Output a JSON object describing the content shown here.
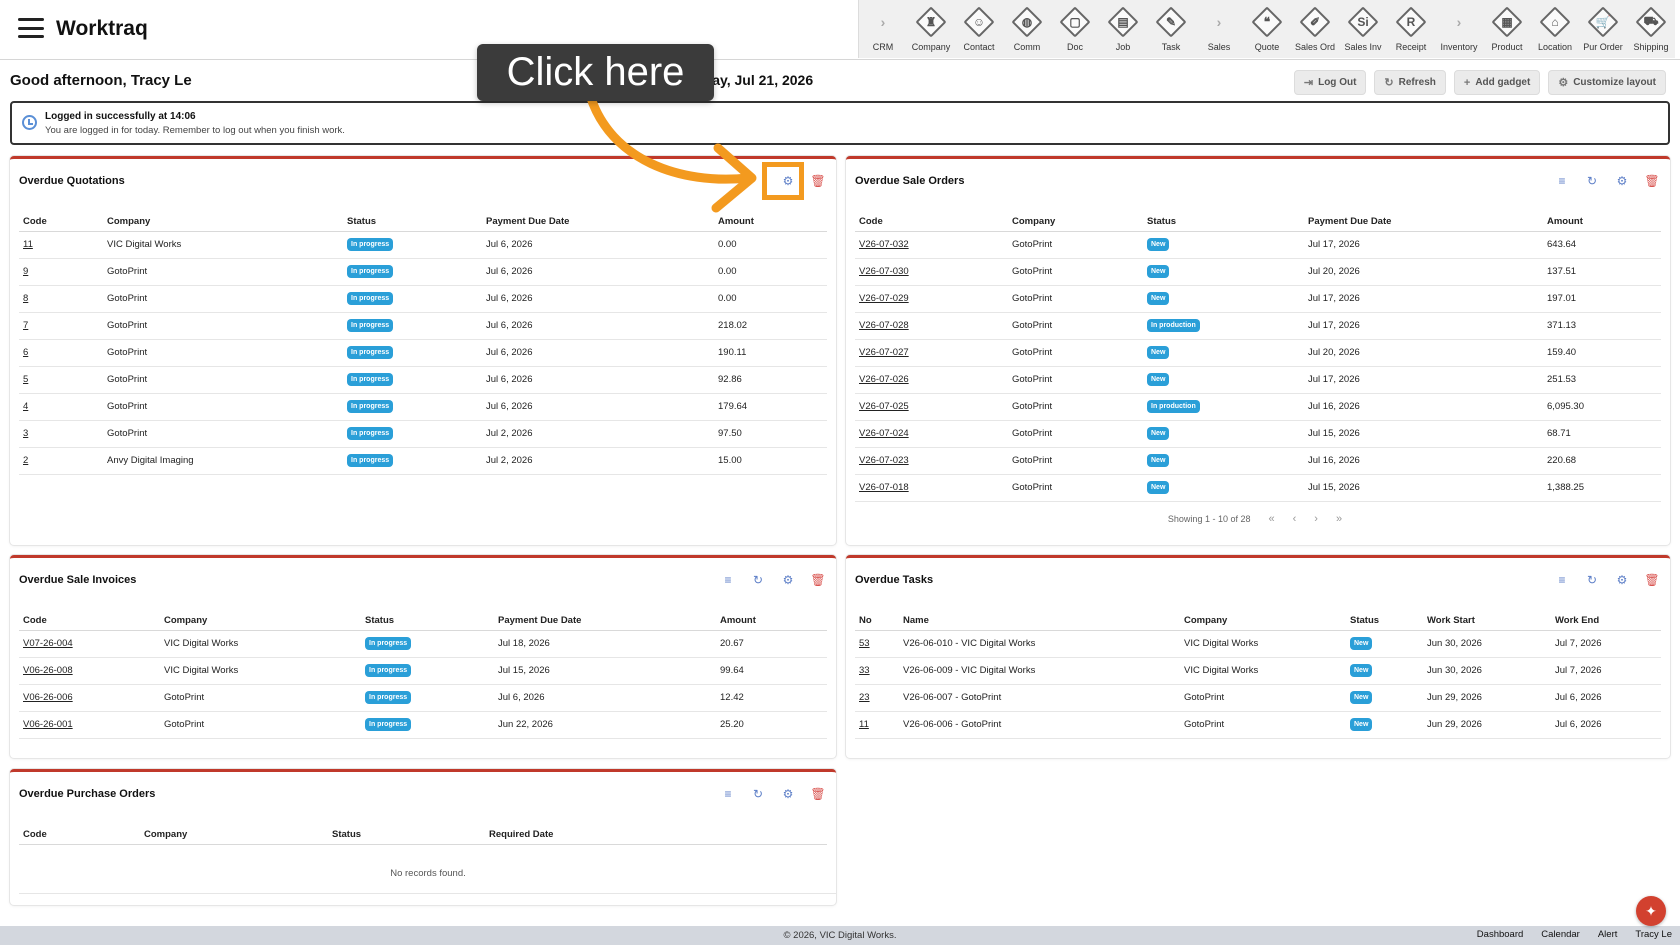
{
  "app": {
    "brand": "Worktraq",
    "modules": [
      {
        "label": "CRM",
        "icon": "chevron-right-icon",
        "glyph": "›",
        "arrow": true
      },
      {
        "label": "Company",
        "icon": "company-icon",
        "glyph": "♜",
        "arrow": false
      },
      {
        "label": "Contact",
        "icon": "contact-icon",
        "glyph": "☺",
        "arrow": false
      },
      {
        "label": "Comm",
        "icon": "comm-icon",
        "glyph": "◍",
        "arrow": false
      },
      {
        "label": "Doc",
        "icon": "doc-icon",
        "glyph": "▢",
        "arrow": false
      },
      {
        "label": "Job",
        "icon": "job-icon",
        "glyph": "▤",
        "arrow": false
      },
      {
        "label": "Task",
        "icon": "task-icon",
        "glyph": "✎",
        "arrow": false
      },
      {
        "label": "Sales",
        "icon": "chevron-right-icon",
        "glyph": "›",
        "arrow": true
      },
      {
        "label": "Quote",
        "icon": "quote-icon",
        "glyph": "❝",
        "arrow": false
      },
      {
        "label": "Sales Ord",
        "icon": "sales-order-icon",
        "glyph": "✐",
        "arrow": false
      },
      {
        "label": "Sales Inv",
        "icon": "sales-invoice-icon",
        "glyph": "Si",
        "arrow": false
      },
      {
        "label": "Receipt",
        "icon": "receipt-icon",
        "glyph": "R",
        "arrow": false
      },
      {
        "label": "Inventory",
        "icon": "chevron-right-icon",
        "glyph": "›",
        "arrow": true
      },
      {
        "label": "Product",
        "icon": "product-icon",
        "glyph": "▦",
        "arrow": false
      },
      {
        "label": "Location",
        "icon": "location-icon",
        "glyph": "⌂",
        "arrow": false
      },
      {
        "label": "Pur Order",
        "icon": "purchase-order-icon",
        "glyph": "🛒",
        "arrow": false
      },
      {
        "label": "Shipping",
        "icon": "shipping-icon",
        "glyph": "⛟",
        "arrow": false
      }
    ]
  },
  "header": {
    "greeting": "Good afternoon, Tracy Le",
    "date": "Tuesday, Jul 21, 2026",
    "buttons": {
      "logout": "Log Out",
      "refresh": "Refresh",
      "add_gadget": "Add gadget",
      "customize": "Customize layout"
    }
  },
  "notice": {
    "title": "Logged in successfully at 14:06",
    "text": "You are logged in for today. Remember to log out when you finish work."
  },
  "quotations": {
    "title": "Overdue Quotations",
    "columns": [
      "Code",
      "Company",
      "Status",
      "Payment Due Date",
      "Amount"
    ],
    "rows": [
      {
        "code": "11",
        "company": "VIC Digital Works",
        "status": "In progress",
        "due": "Jul 6, 2026",
        "amount": "0.00"
      },
      {
        "code": "9",
        "company": "GotoPrint",
        "status": "In progress",
        "due": "Jul 6, 2026",
        "amount": "0.00"
      },
      {
        "code": "8",
        "company": "GotoPrint",
        "status": "In progress",
        "due": "Jul 6, 2026",
        "amount": "0.00"
      },
      {
        "code": "7",
        "company": "GotoPrint",
        "status": "In progress",
        "due": "Jul 6, 2026",
        "amount": "218.02"
      },
      {
        "code": "6",
        "company": "GotoPrint",
        "status": "In progress",
        "due": "Jul 6, 2026",
        "amount": "190.11"
      },
      {
        "code": "5",
        "company": "GotoPrint",
        "status": "In progress",
        "due": "Jul 6, 2026",
        "amount": "92.86"
      },
      {
        "code": "4",
        "company": "GotoPrint",
        "status": "In progress",
        "due": "Jul 6, 2026",
        "amount": "179.64"
      },
      {
        "code": "3",
        "company": "GotoPrint",
        "status": "In progress",
        "due": "Jul 2, 2026",
        "amount": "97.50"
      },
      {
        "code": "2",
        "company": "Anvy Digital Imaging",
        "status": "In progress",
        "due": "Jul 2, 2026",
        "amount": "15.00"
      }
    ]
  },
  "sale_orders": {
    "title": "Overdue Sale Orders",
    "columns": [
      "Code",
      "Company",
      "Status",
      "Payment Due Date",
      "Amount"
    ],
    "rows": [
      {
        "code": "V26-07-032",
        "company": "GotoPrint",
        "status": "New",
        "due": "Jul 17, 2026",
        "amount": "643.64"
      },
      {
        "code": "V26-07-030",
        "company": "GotoPrint",
        "status": "New",
        "due": "Jul 20, 2026",
        "amount": "137.51"
      },
      {
        "code": "V26-07-029",
        "company": "GotoPrint",
        "status": "New",
        "due": "Jul 17, 2026",
        "amount": "197.01"
      },
      {
        "code": "V26-07-028",
        "company": "GotoPrint",
        "status": "In production",
        "due": "Jul 17, 2026",
        "amount": "371.13"
      },
      {
        "code": "V26-07-027",
        "company": "GotoPrint",
        "status": "New",
        "due": "Jul 20, 2026",
        "amount": "159.40"
      },
      {
        "code": "V26-07-026",
        "company": "GotoPrint",
        "status": "New",
        "due": "Jul 17, 2026",
        "amount": "251.53"
      },
      {
        "code": "V26-07-025",
        "company": "GotoPrint",
        "status": "In production",
        "due": "Jul 16, 2026",
        "amount": "6,095.30"
      },
      {
        "code": "V26-07-024",
        "company": "GotoPrint",
        "status": "New",
        "due": "Jul 15, 2026",
        "amount": "68.71"
      },
      {
        "code": "V26-07-023",
        "company": "GotoPrint",
        "status": "New",
        "due": "Jul 16, 2026",
        "amount": "220.68"
      },
      {
        "code": "V26-07-018",
        "company": "GotoPrint",
        "status": "New",
        "due": "Jul 15, 2026",
        "amount": "1,388.25"
      }
    ],
    "pager_text": "Showing 1 - 10 of 28",
    "pager": {
      "first": "«",
      "prev": "‹",
      "next": "›",
      "last": "»"
    }
  },
  "sale_invoices": {
    "title": "Overdue Sale Invoices",
    "columns": [
      "Code",
      "Company",
      "Status",
      "Payment Due Date",
      "Amount"
    ],
    "rows": [
      {
        "code": "V07-26-004",
        "company": "VIC Digital Works",
        "status": "In progress",
        "due": "Jul 18, 2026",
        "amount": "20.67"
      },
      {
        "code": "V06-26-008",
        "company": "VIC Digital Works",
        "status": "In progress",
        "due": "Jul 15, 2026",
        "amount": "99.64"
      },
      {
        "code": "V06-26-006",
        "company": "GotoPrint",
        "status": "In progress",
        "due": "Jul 6, 2026",
        "amount": "12.42"
      },
      {
        "code": "V06-26-001",
        "company": "GotoPrint",
        "status": "In progress",
        "due": "Jun 22, 2026",
        "amount": "25.20"
      }
    ]
  },
  "tasks": {
    "title": "Overdue Tasks",
    "columns": [
      "No",
      "Name",
      "Company",
      "Status",
      "Work Start",
      "Work End"
    ],
    "rows": [
      {
        "no": "53",
        "name": "V26-06-010 - VIC Digital Works",
        "company": "VIC Digital Works",
        "status": "New",
        "start": "Jun 30, 2026",
        "end": "Jul 7, 2026"
      },
      {
        "no": "33",
        "name": "V26-06-009 - VIC Digital Works",
        "company": "VIC Digital Works",
        "status": "New",
        "start": "Jun 30, 2026",
        "end": "Jul 7, 2026"
      },
      {
        "no": "23",
        "name": "V26-06-007 - GotoPrint",
        "company": "GotoPrint",
        "status": "New",
        "start": "Jun 29, 2026",
        "end": "Jul 6, 2026"
      },
      {
        "no": "11",
        "name": "V26-06-006 - GotoPrint",
        "company": "GotoPrint",
        "status": "New",
        "start": "Jun 29, 2026",
        "end": "Jul 6, 2026"
      }
    ]
  },
  "purchase_orders": {
    "title": "Overdue Purchase Orders",
    "columns": [
      "Code",
      "Company",
      "Status",
      "Required Date"
    ],
    "empty_text": "No records found."
  },
  "footer": {
    "copyright": "© 2026, VIC Digital Works.",
    "links": [
      "Dashboard",
      "Calendar",
      "Alert",
      "Tracy Le"
    ]
  },
  "tutorial": {
    "callout": "Click here",
    "accent_color": "#f39a1f"
  },
  "colors": {
    "panel_accent": "#c0392b",
    "badge": "#2a9fd8",
    "tool_icon": "#5c7ec7",
    "delete_icon": "#d9534f"
  }
}
